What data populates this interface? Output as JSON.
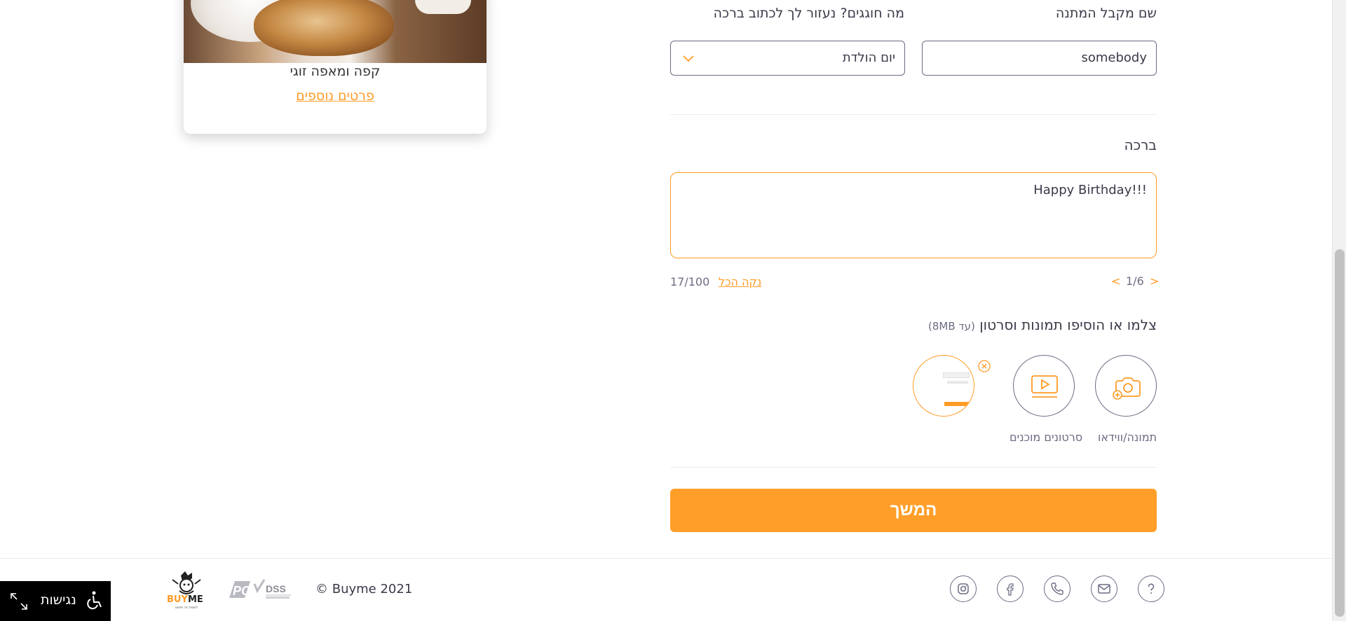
{
  "product_card": {
    "title": "קפה ומאפה זוגי",
    "details_link": "פרטים נוספים"
  },
  "form": {
    "recipient_label": "שם מקבל המתנה",
    "recipient_value": "somebody",
    "occasion_label": "מה חוגגים? נעזור לך לכתוב ברכה",
    "occasion_value": "יום הולדת",
    "greeting_label": "ברכה",
    "greeting_value": "Happy Birthday!!!",
    "pager_current": "1/6",
    "pager_prev": "<",
    "pager_next": ">",
    "clear_all": "נקה הכל",
    "char_count": "17/100",
    "media_title": "צלמו או הוסיפו תמונות וסרטון",
    "media_limit": "(עד 8MB)",
    "photo_video_caption": "תמונה/ווידאו",
    "ready_videos_caption": "סרטונים מוכנים",
    "continue_button": "המשך"
  },
  "footer": {
    "copyright": "© Buyme 2021",
    "buyme_tagline": "לשמח זה פשוט"
  },
  "accessibility": {
    "label": "נגישות"
  },
  "icons": [
    "camera-plus-icon",
    "video-play-icon",
    "close-circle-icon",
    "chevron-down-icon",
    "help-icon",
    "mail-icon",
    "phone-icon",
    "facebook-icon",
    "instagram-icon",
    "wheelchair-icon",
    "expand-icon"
  ],
  "colors": {
    "accent": "#ff9f2a",
    "border": "#6c6c84",
    "text": "#3a3a4a"
  }
}
